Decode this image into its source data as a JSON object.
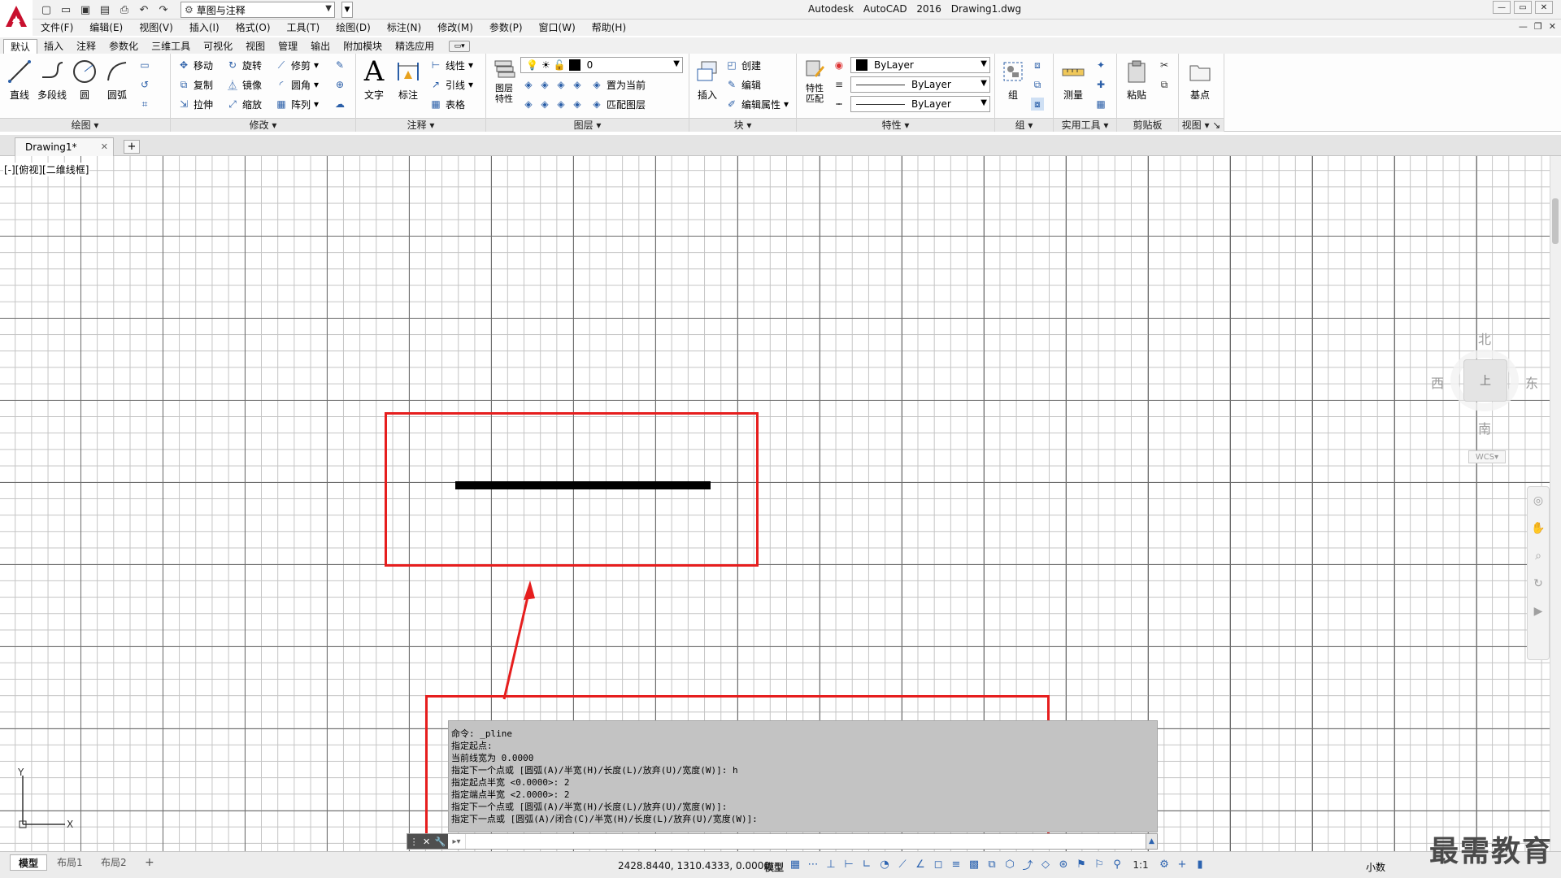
{
  "window": {
    "app_title": "Autodesk AutoCAD 2016",
    "file_name": "Drawing1.dwg",
    "workspace": "草图与注释"
  },
  "menu": [
    "文件(F)",
    "编辑(E)",
    "视图(V)",
    "插入(I)",
    "格式(O)",
    "工具(T)",
    "绘图(D)",
    "标注(N)",
    "修改(M)",
    "参数(P)",
    "窗口(W)",
    "帮助(H)"
  ],
  "ribbon_tabs": [
    "默认",
    "插入",
    "注释",
    "参数化",
    "三维工具",
    "可视化",
    "视图",
    "管理",
    "输出",
    "附加模块",
    "精选应用"
  ],
  "ribbon": {
    "draw": {
      "title": "绘图",
      "line": "直线",
      "polyline": "多段线",
      "circle": "圆",
      "arc": "圆弧"
    },
    "modify": {
      "title": "修改",
      "move": "移动",
      "rotate": "旋转",
      "trim": "修剪",
      "copy": "复制",
      "mirror": "镜像",
      "fillet": "圆角",
      "stretch": "拉伸",
      "scale": "缩放",
      "array": "阵列"
    },
    "annotation": {
      "title": "注释",
      "text": "文字",
      "dimension": "标注",
      "linear": "线性",
      "leader": "引线",
      "table": "表格"
    },
    "layers": {
      "title": "图层",
      "properties": "图层\n特性",
      "current_layer": "0",
      "make_current": "置为当前",
      "match_layer": "匹配图层"
    },
    "block": {
      "title": "块",
      "insert": "插入",
      "create": "创建",
      "edit": "编辑",
      "edit_attr": "编辑属性"
    },
    "properties": {
      "title": "特性",
      "match": "特性\n匹配",
      "color": "ByLayer",
      "linetype": "ByLayer",
      "lineweight": "ByLayer"
    },
    "groups": {
      "title": "组",
      "group": "组"
    },
    "utilities": {
      "title": "实用工具",
      "measure": "测量"
    },
    "clipboard": {
      "title": "剪贴板",
      "paste": "粘贴"
    },
    "view": {
      "title": "视图",
      "base": "基点"
    }
  },
  "doc_tab": {
    "label": "Drawing1*"
  },
  "viewport_label": "[-][俯视][二维线框]",
  "viewcube": {
    "north": "北",
    "south": "南",
    "east": "东",
    "west": "西",
    "face": "上",
    "wcs": "WCS"
  },
  "command": {
    "history": [
      "命令: _pline",
      "指定起点:",
      "当前线宽为 0.0000",
      "指定下一个点或 [圆弧(A)/半宽(H)/长度(L)/放弃(U)/宽度(W)]: h",
      "指定起点半宽 <0.0000>: 2",
      "指定端点半宽 <2.0000>: 2",
      "指定下一个点或 [圆弧(A)/半宽(H)/长度(L)/放弃(U)/宽度(W)]:",
      "指定下一点或 [圆弧(A)/闭合(C)/半宽(H)/长度(L)/放弃(U)/宽度(W)]:"
    ],
    "input_value": ""
  },
  "status": {
    "layouts": [
      "模型",
      "布局1",
      "布局2"
    ],
    "coords": "2428.8440, 1310.4333, 0.0000",
    "space": "模型",
    "scale": "1:1",
    "units": "小数"
  },
  "watermark": "最需教育",
  "colors": {
    "highlight": "#e61e1e",
    "command_bg": "#c3c3c3"
  }
}
